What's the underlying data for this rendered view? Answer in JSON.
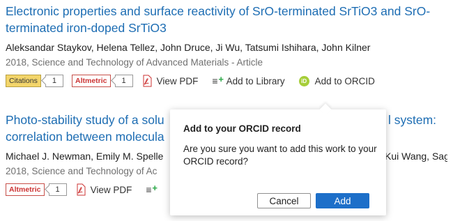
{
  "records": [
    {
      "title": "Electronic properties and surface reactivity of SrO-terminated SrTiO3 and SrO-terminated iron-doped SrTiO3",
      "authors": "Aleksandar Staykov, Helena Tellez, John Druce, Ji Wu, Tatsumi Ishihara, John Kilner",
      "meta": "2018, Science and Technology of Advanced Materials - Article",
      "citations_label": "Citations",
      "citations_count": "1",
      "altmetric_label": "Altmetric",
      "altmetric_count": "1",
      "view_pdf": "View PDF",
      "add_library": "Add to Library",
      "add_orcid": "Add to ORCID"
    },
    {
      "title_left": "Photo-stability study of a solu",
      "title_right": "l system:",
      "title_line2": "correlation between molecula",
      "authors_left": "Michael J. Newman, Emily M. Spelle",
      "authors_right": "Kui Wang, Sag…",
      "meta_left": "2018, Science and Technology of Ac",
      "altmetric_label": "Altmetric",
      "altmetric_count": "1",
      "view_pdf": "View PDF"
    }
  ],
  "modal": {
    "title": "Add to your ORCID record",
    "body": "Are you sure you want to add this work to your ORCID record?",
    "cancel": "Cancel",
    "add": "Add"
  },
  "icons": {
    "orcid": "orcid-icon",
    "pdf": "pdf-icon",
    "library": "add-to-library-icon"
  },
  "colors": {
    "link": "#1d6db3",
    "primary_button": "#1d6fc9",
    "orcid_green": "#a6ce39"
  }
}
